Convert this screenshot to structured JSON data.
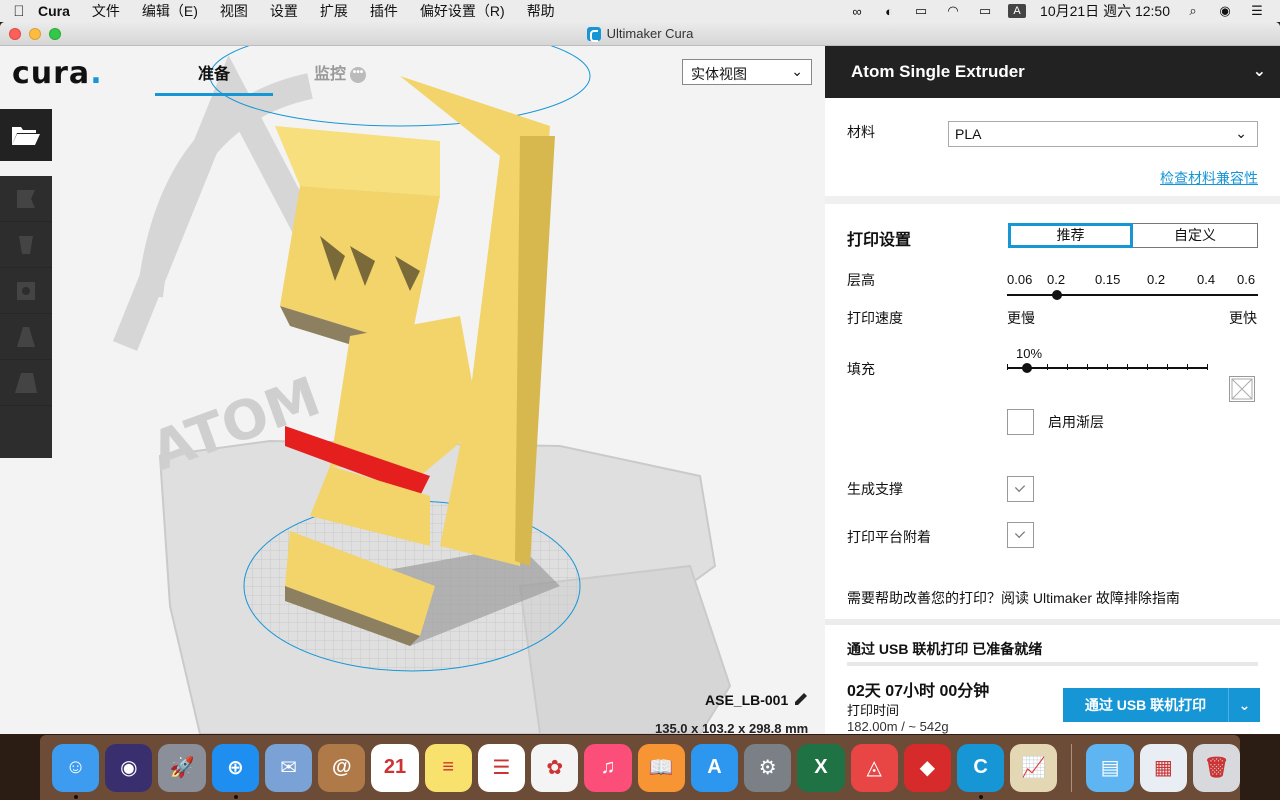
{
  "menubar": {
    "items": [
      "Cura",
      "文件",
      "编辑（E)",
      "视图",
      "设置",
      "扩展",
      "插件",
      "偏好设置（R)",
      "帮助"
    ],
    "clock": "10月21日 週六 12:50",
    "input_source": "A"
  },
  "window": {
    "title": "Ultimaker Cura"
  },
  "header": {
    "logo": "cura",
    "tabs": [
      {
        "label": "准备",
        "active": true
      },
      {
        "label": "监控",
        "active": false
      }
    ],
    "view_mode": "实体视图"
  },
  "viewport": {
    "model_name": "ASE_LB-001",
    "model_dimensions": "135.0 x 103.2 x 298.8 mm"
  },
  "toolbar": {
    "tools": [
      "move-icon",
      "scale-icon",
      "rotate-icon",
      "mirror-icon",
      "per-model-settings-icon"
    ]
  },
  "panel": {
    "printer_name": "Atom Single Extruder",
    "material_label": "材料",
    "material_value": "PLA",
    "compat_link": "检查材料兼容性",
    "print_setup_title": "打印设置",
    "mode_recommended": "推荐",
    "mode_custom": "自定义",
    "layer_height_label": "层高",
    "layer_height_ticks": [
      "0.06",
      "0.2",
      "0.15",
      "0.2",
      "0.4",
      "0.6"
    ],
    "layer_height_selected_index": 1,
    "print_speed_label": "打印速度",
    "speed_slow": "更慢",
    "speed_fast": "更快",
    "infill_label": "填充",
    "infill_value": "10%",
    "infill_fraction": 0.1,
    "gradual_label": "启用渐层",
    "gradual_checked": false,
    "support_label": "生成支撑",
    "support_checked": true,
    "adhesion_label": "打印平台附着",
    "adhesion_checked": true,
    "help_text": "需要帮助改善您的打印？阅读 Ultimaker 故障排除指南",
    "status": "通过 USB 联机打印 已准备就绪",
    "print_time": "02天 07小时 00分钟",
    "print_time_label": "打印时间",
    "material_usage": "182.00m / ~ 542g",
    "print_button": "通过 USB 联机打印"
  },
  "dock": {
    "apps": [
      {
        "name": "finder-icon",
        "color": "#3d9cf0",
        "glyph": "☺",
        "running": true
      },
      {
        "name": "siri-icon",
        "color": "#3a2f6e",
        "glyph": "◉",
        "running": false
      },
      {
        "name": "launchpad-icon",
        "color": "#8a8f99",
        "glyph": "🚀",
        "running": false
      },
      {
        "name": "safari-icon",
        "color": "#1e8ff0",
        "glyph": "⊕",
        "running": true
      },
      {
        "name": "mail-icon",
        "color": "#7aa2d6",
        "glyph": "✉",
        "running": false
      },
      {
        "name": "contacts-icon",
        "color": "#b07a48",
        "glyph": "@",
        "running": false
      },
      {
        "name": "calendar-icon",
        "color": "#ffffff",
        "glyph": "21",
        "running": false
      },
      {
        "name": "notes-icon",
        "color": "#f8e16c",
        "glyph": "≡",
        "running": false
      },
      {
        "name": "reminders-icon",
        "color": "#ffffff",
        "glyph": "☰",
        "running": false
      },
      {
        "name": "photos-icon",
        "color": "#f4f4f4",
        "glyph": "✿",
        "running": false
      },
      {
        "name": "itunes-icon",
        "color": "#fb4f7a",
        "glyph": "♫",
        "running": false
      },
      {
        "name": "ibooks-icon",
        "color": "#f79433",
        "glyph": "📖",
        "running": false
      },
      {
        "name": "app-store-icon",
        "color": "#2d97f0",
        "glyph": "A",
        "running": false
      },
      {
        "name": "system-preferences-icon",
        "color": "#7b7f86",
        "glyph": "⚙",
        "running": false
      },
      {
        "name": "excel-icon",
        "color": "#1f7244",
        "glyph": "X",
        "running": false
      },
      {
        "name": "atom-app-icon",
        "color": "#e84545",
        "glyph": "◬",
        "running": false
      },
      {
        "name": "sketchup-icon",
        "color": "#d72a2a",
        "glyph": "◆",
        "running": false
      },
      {
        "name": "cura-icon",
        "color": "#1796d6",
        "glyph": "C",
        "running": true
      },
      {
        "name": "preview-icon",
        "color": "#e4d8b4",
        "glyph": "📈",
        "running": false
      }
    ],
    "right": [
      {
        "name": "downloads-folder-icon",
        "color": "#5fb4f2",
        "glyph": "▤"
      },
      {
        "name": "documents-stack-icon",
        "color": "#e9eef5",
        "glyph": "▦"
      },
      {
        "name": "trash-icon",
        "color": "#d7d9dd",
        "glyph": "🗑"
      }
    ]
  }
}
